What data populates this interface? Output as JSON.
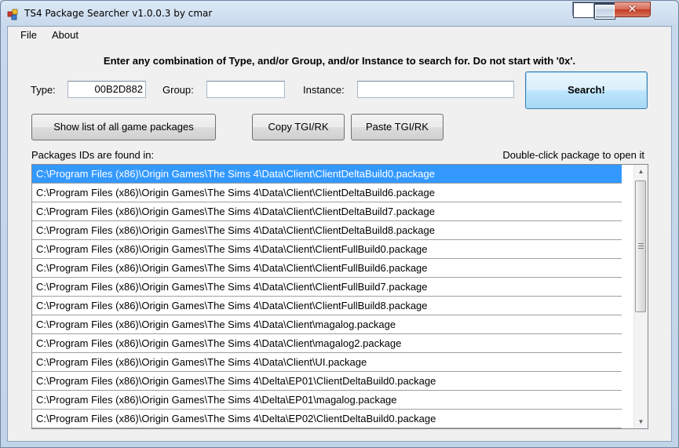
{
  "window": {
    "title": "TS4 Package Searcher v1.0.0.3 by cmar",
    "controls": {
      "minimize": "minimize",
      "maximize": "maximize",
      "close": "✕"
    }
  },
  "menu": {
    "file": "File",
    "about": "About"
  },
  "instructions": "Enter any combination of Type, and/or Group, and/or Instance to search for. Do not start with '0x'.",
  "search": {
    "type_label": "Type:",
    "type_value": "00B2D882",
    "group_label": "Group:",
    "group_value": "",
    "instance_label": "Instance:",
    "instance_value": "",
    "search_button": "Search!"
  },
  "buttons": {
    "show_list": "Show list of all game packages",
    "copy": "Copy TGI/RK",
    "paste": "Paste TGI/RK"
  },
  "results": {
    "header_left": "Packages IDs are found in:",
    "header_right": "Double-click package to open it",
    "selected_index": 0,
    "items": [
      "C:\\Program Files (x86)\\Origin Games\\The Sims 4\\Data\\Client\\ClientDeltaBuild0.package",
      "C:\\Program Files (x86)\\Origin Games\\The Sims 4\\Data\\Client\\ClientDeltaBuild6.package",
      "C:\\Program Files (x86)\\Origin Games\\The Sims 4\\Data\\Client\\ClientDeltaBuild7.package",
      "C:\\Program Files (x86)\\Origin Games\\The Sims 4\\Data\\Client\\ClientDeltaBuild8.package",
      "C:\\Program Files (x86)\\Origin Games\\The Sims 4\\Data\\Client\\ClientFullBuild0.package",
      "C:\\Program Files (x86)\\Origin Games\\The Sims 4\\Data\\Client\\ClientFullBuild6.package",
      "C:\\Program Files (x86)\\Origin Games\\The Sims 4\\Data\\Client\\ClientFullBuild7.package",
      "C:\\Program Files (x86)\\Origin Games\\The Sims 4\\Data\\Client\\ClientFullBuild8.package",
      "C:\\Program Files (x86)\\Origin Games\\The Sims 4\\Data\\Client\\magalog.package",
      "C:\\Program Files (x86)\\Origin Games\\The Sims 4\\Data\\Client\\magalog2.package",
      "C:\\Program Files (x86)\\Origin Games\\The Sims 4\\Data\\Client\\UI.package",
      "C:\\Program Files (x86)\\Origin Games\\The Sims 4\\Delta\\EP01\\ClientDeltaBuild0.package",
      "C:\\Program Files (x86)\\Origin Games\\The Sims 4\\Delta\\EP01\\magalog.package",
      "C:\\Program Files (x86)\\Origin Games\\The Sims 4\\Delta\\EP02\\ClientDeltaBuild0.package"
    ]
  },
  "colors": {
    "selection": "#3399ff",
    "close_button": "#c43c25",
    "title_bar": "#c7d9ec"
  }
}
